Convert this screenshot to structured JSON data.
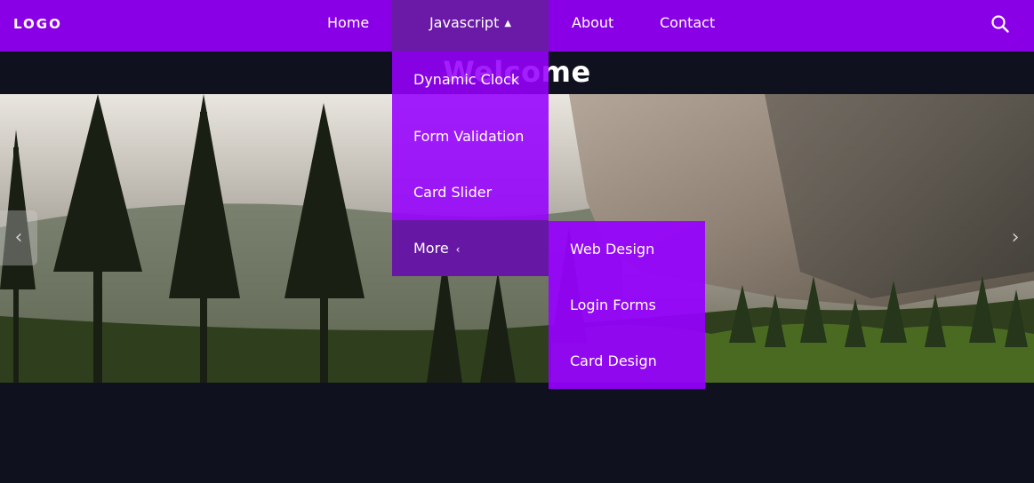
{
  "navbar": {
    "logo": "LOGO",
    "links": [
      "Home",
      "Javascript",
      "About",
      "Contact"
    ],
    "search_icon": "search-icon",
    "background": "#8a00e6",
    "active_background": "#6a1aa6"
  },
  "hero": {
    "title": "Welcome",
    "prev_icon": "‹",
    "next_icon": "›"
  },
  "dropdown": {
    "items": [
      "Dynamic Clock",
      "Form Validation",
      "Card Slider",
      "More"
    ],
    "more_chevron": "‹",
    "submenu": [
      "Web Design",
      "Login Forms",
      "Card Design"
    ]
  },
  "nav_js_chevron": "⌃"
}
